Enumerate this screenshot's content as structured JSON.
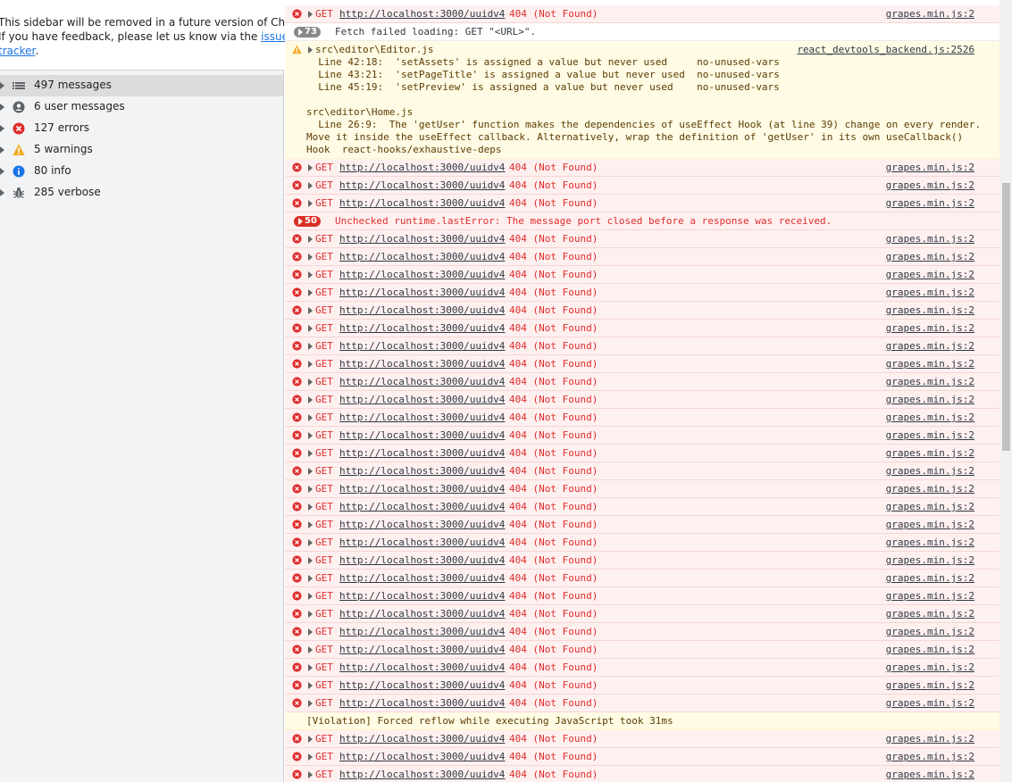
{
  "sidebar": {
    "notice_lines": [
      "This sidebar will be removed in a future version of Chrome.",
      "If you have feedback, please let us know via the"
    ],
    "notice_link_1": "issue",
    "notice_link_2": "tracker",
    "notice_tail": ".",
    "filters": [
      {
        "label": "497 messages",
        "icon": "list-icon"
      },
      {
        "label": "6 user messages",
        "icon": "user-icon"
      },
      {
        "label": "127 errors",
        "icon": "error-icon"
      },
      {
        "label": "5 warnings",
        "icon": "warning-icon"
      },
      {
        "label": "80 info",
        "icon": "info-icon"
      },
      {
        "label": "285 verbose",
        "icon": "bug-icon"
      }
    ]
  },
  "console": {
    "get": "GET",
    "url": "http://localhost:3000/uuidv4",
    "status": "404 (Not Found)",
    "source": "grapes.min.js:2",
    "fetch_badge": "73",
    "fetch_msg": "Fetch failed loading: GET \"<URL>\".",
    "warn_file": "src\\editor\\Editor.js",
    "warn_source": "react_devtools_backend.js:2526",
    "warn_lines": [
      "  Line 42:18:  'setAssets' is assigned a value but never used     no-unused-vars",
      "  Line 43:21:  'setPageTitle' is assigned a value but never used  no-unused-vars",
      "  Line 45:19:  'setPreview' is assigned a value but never used    no-unused-vars",
      "",
      "src\\editor\\Home.js",
      "  Line 26:9:  The 'getUser' function makes the dependencies of useEffect Hook (at line 39) change on every render.",
      "Move it inside the useEffect callback. Alternatively, wrap the definition of 'getUser' in its own useCallback()",
      "Hook  react-hooks/exhaustive-deps"
    ],
    "runtime_badge": "50",
    "runtime_msg": "Unchecked runtime.lastError: The message port closed before a response was received.",
    "violation_msg": "[Violation] Forced reflow while executing JavaScript took 31ms",
    "colors": {
      "error": "#e02d2d",
      "warning_bg": "#fffbe5",
      "error_bg": "#fff0f0"
    }
  }
}
